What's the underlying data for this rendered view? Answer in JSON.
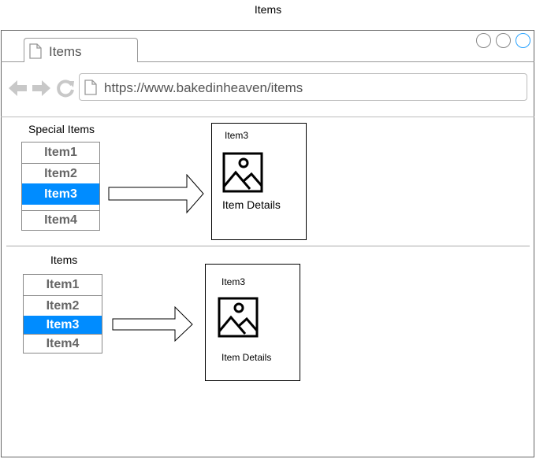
{
  "page": {
    "title": "Items"
  },
  "browser": {
    "tab_label": "Items",
    "url": "https://www.bakedinheaven/items",
    "window_controls": [
      "circle",
      "circle",
      "circle-active"
    ],
    "colors": {
      "selected": "#008cff",
      "active_control": "#29a3ff"
    }
  },
  "section1": {
    "title": "Special Items",
    "items": [
      "Item1",
      "Item2",
      "Item3",
      "Item4"
    ],
    "selected_item": "Item3",
    "card": {
      "title": "Item3",
      "details": "Item Details"
    }
  },
  "section2": {
    "title": "Items",
    "items": [
      "Item1",
      "Item2",
      "Item3",
      "Item4"
    ],
    "selected_item": "Item3",
    "card": {
      "title": "Item3",
      "details": "Item Details"
    }
  }
}
